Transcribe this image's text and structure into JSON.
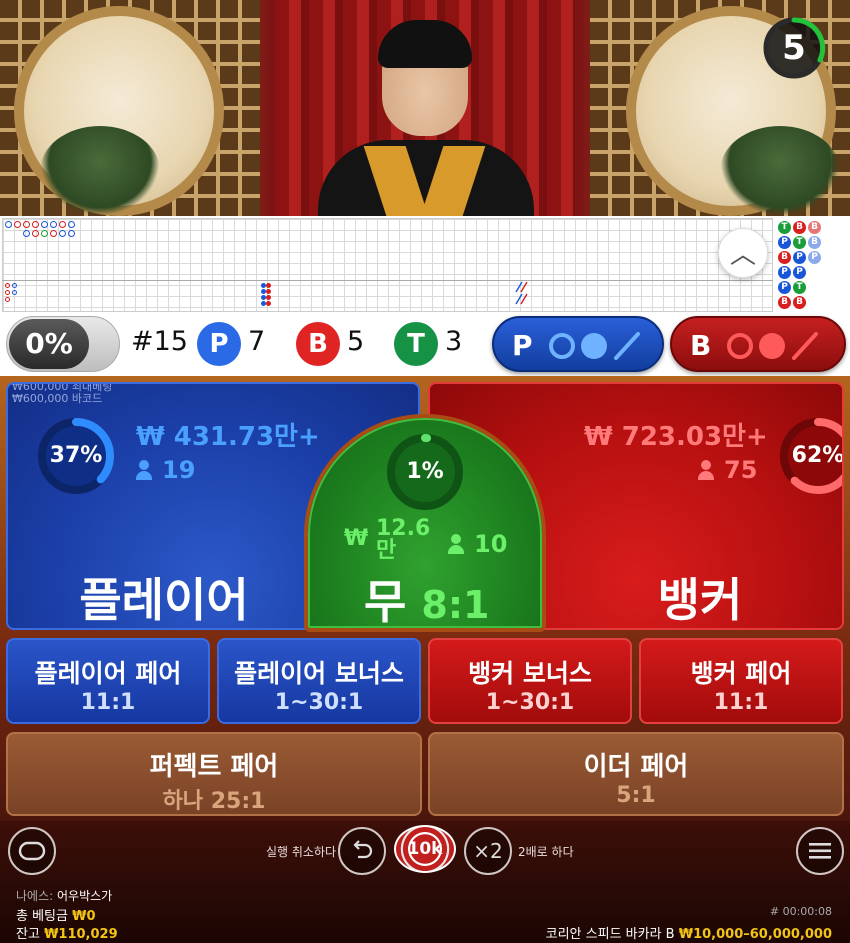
{
  "timer": {
    "value": "5"
  },
  "roadmap": {
    "expand_label": "︿"
  },
  "stats": {
    "percent": "0%",
    "round": "#15",
    "player_letter": "P",
    "player_count": "7",
    "banker_letter": "B",
    "banker_count": "5",
    "tie_letter": "T",
    "tie_count": "3",
    "player_ask": "P",
    "banker_ask": "B"
  },
  "player": {
    "percent": "37%",
    "percent_value": 37,
    "amount": "₩ 431.73만+",
    "players": "19",
    "label": "플레이어",
    "limits": [
      "₩600,000 최대베팅",
      "₩600,000 바코드"
    ]
  },
  "banker": {
    "percent": "62%",
    "percent_value": 62,
    "amount": "₩ 723.03만+",
    "players": "75",
    "label": "뱅커"
  },
  "tie": {
    "percent": "1%",
    "percent_value": 1,
    "amount_symbol": "₩",
    "amount": "12.6",
    "amount_unit": "만",
    "players": "10",
    "label": "무",
    "odds": "8:1"
  },
  "side_bets": [
    {
      "title": "플레이어 페어",
      "odds": "11:1"
    },
    {
      "title": "플레이어 보너스",
      "odds": "1~30:1"
    },
    {
      "title": "뱅커 보너스",
      "odds": "1~30:1"
    },
    {
      "title": "뱅커 페어",
      "odds": "11:1"
    }
  ],
  "wide_bets": [
    {
      "title": "퍼펙트 페어",
      "odds": "하나 25:1"
    },
    {
      "title": "이더 페어",
      "odds": "5:1"
    }
  ],
  "controls": {
    "undo_label": "실행 취소하다",
    "chip_label": "10k",
    "double_icon": "×2",
    "double_label": "2배로 하다"
  },
  "footer": {
    "nickname_label": "나에스:",
    "nickname": "어우박스가",
    "total_bet_label": "총 베팅금",
    "total_bet": "₩0",
    "balance_label": "잔고",
    "balance": "₩110,029",
    "round_id": "# 00:00:08",
    "table_name": "코리안 스피드 바카라 B",
    "table_limits": "₩10,000–60,000,000"
  },
  "colors": {
    "player_blue": "#1b3fa8",
    "banker_red": "#b71010",
    "tie_green": "#1c7e1e",
    "timer_green": "#22c33a",
    "gold": "#f2c418"
  },
  "icons": [
    "chat-icon",
    "undo-icon",
    "menu-icon",
    "user-icon",
    "chevron-up-icon"
  ]
}
